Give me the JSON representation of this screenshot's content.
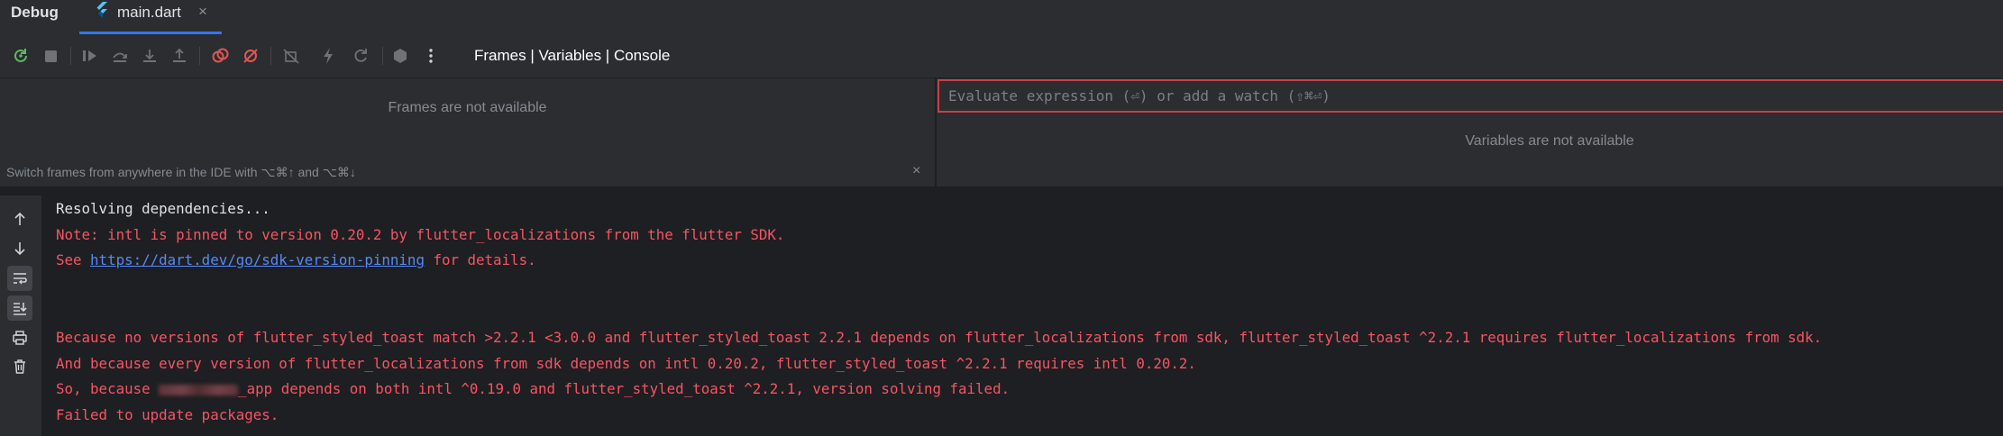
{
  "tool_window": {
    "title": "Debug"
  },
  "tabs": [
    {
      "label": "main.dart",
      "close": "×"
    }
  ],
  "toolbar": {
    "tabs_label": "Frames | Variables | Console"
  },
  "frames": {
    "empty": "Frames are not available",
    "hint": "Switch frames from anywhere in the IDE with ⌥⌘↑ and ⌥⌘↓",
    "close": "×"
  },
  "variables": {
    "placeholder": "Evaluate expression (⏎) or add a watch (⇧⌘⏎)",
    "empty": "Variables are not available"
  },
  "console": {
    "lines": [
      "Resolving dependencies...",
      "Note: intl is pinned to version 0.20.2 by flutter_localizations from the flutter SDK.",
      "See ",
      "https://dart.dev/go/sdk-version-pinning",
      " for details.",
      "Because no versions of flutter_styled_toast match >2.2.1 <3.0.0 and flutter_styled_toast 2.2.1 depends on flutter_localizations from sdk, flutter_styled_toast ^2.2.1 requires flutter_localizations from sdk.",
      "And because every version of flutter_localizations from sdk depends on intl 0.20.2, flutter_styled_toast ^2.2.1 requires intl 0.20.2.",
      "So, because ",
      "_app depends on both intl ^0.19.0 and flutter_styled_toast ^2.2.1, version solving failed.",
      "Failed to update packages."
    ]
  },
  "colors": {
    "accent": "#3574f0",
    "error": "#f75464",
    "link": "#548af7",
    "input_border": "#c7404a"
  }
}
